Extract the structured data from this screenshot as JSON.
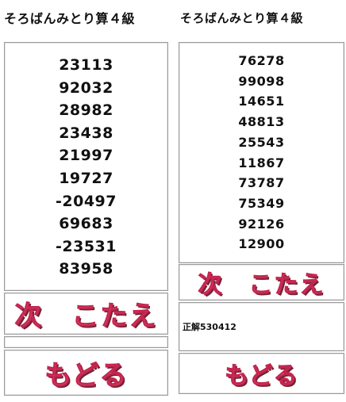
{
  "left_panel": {
    "title": "そろばんみとり算４級",
    "numbers": [
      "23113",
      "92032",
      "28982",
      "23438",
      "21997",
      "19727",
      "-20497",
      "69683",
      "-23531",
      "83958"
    ],
    "next_button": "次　こたえ",
    "answer": "",
    "back_button": "もどる"
  },
  "right_panel": {
    "title": "そろばんみとり算４級",
    "numbers": [
      "76278",
      "99098",
      "14651",
      "48813",
      "25543",
      "11867",
      "73787",
      "75349",
      "92126",
      "12900"
    ],
    "next_button": "次　こたえ",
    "answer": "正解530412",
    "back_button": "もどる"
  },
  "colors": {
    "button_text": "#d9476b",
    "button_shadow": "#6e2233",
    "border": "#9a9a9a"
  }
}
